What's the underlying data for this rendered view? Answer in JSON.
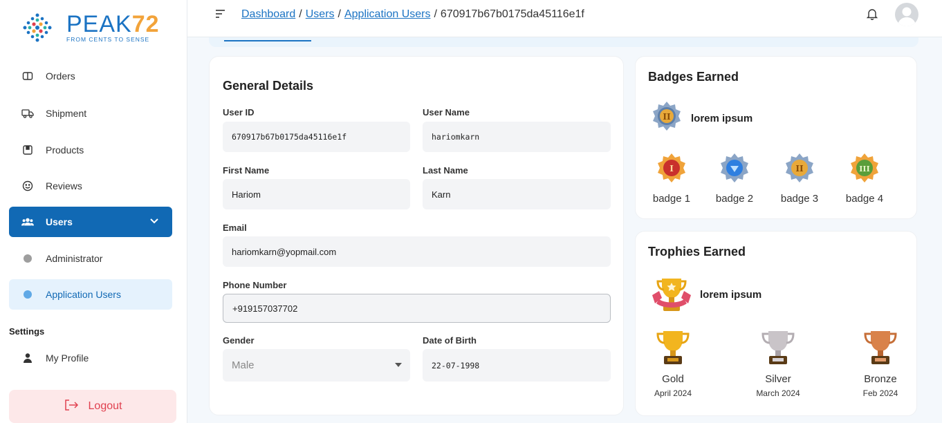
{
  "brand": {
    "name": "PEAK",
    "number": "72",
    "tagline": "FROM CENTS TO SENSE"
  },
  "sidebar": {
    "items": [
      {
        "label": "Orders",
        "icon": "orders-icon"
      },
      {
        "label": "Shipment",
        "icon": "truck-icon"
      },
      {
        "label": "Products",
        "icon": "box-icon"
      },
      {
        "label": "Reviews",
        "icon": "smiley-icon"
      },
      {
        "label": "Users",
        "icon": "users-icon"
      },
      {
        "label": "Administrator",
        "icon": "dot-icon"
      },
      {
        "label": "Application Users",
        "icon": "dot-icon"
      }
    ],
    "settings_label": "Settings",
    "settings_items": [
      {
        "label": "My Profile",
        "icon": "person-icon"
      }
    ],
    "logout_label": "Logout"
  },
  "breadcrumb": {
    "items": [
      "Dashboard",
      "Users",
      "Application Users"
    ],
    "current": "670917b67b0175da45116e1f",
    "separator": "/"
  },
  "details": {
    "title": "General Details",
    "user_id_label": "User ID",
    "user_id": "670917b67b0175da45116e1f",
    "user_name_label": "User Name",
    "user_name": "hariomkarn",
    "first_name_label": "First Name",
    "first_name": "Hariom",
    "last_name_label": "Last Name",
    "last_name": "Karn",
    "email_label": "Email",
    "email": "hariomkarn@yopmail.com",
    "phone_label": "Phone Number",
    "phone": "+919157037702",
    "gender_label": "Gender",
    "gender": "Male",
    "dob_label": "Date of Birth",
    "dob": "22-07-1998"
  },
  "badges": {
    "title": "Badges Earned",
    "featured": "lorem ipsum",
    "items": [
      {
        "label": "badge 1",
        "color": "#c9302c",
        "numeral": "I"
      },
      {
        "label": "badge 2",
        "color": "#2f7fe0",
        "numeral": ""
      },
      {
        "label": "badge 3",
        "color": "#e8a93a",
        "numeral": "II"
      },
      {
        "label": "badge 4",
        "color": "#5a9e3a",
        "numeral": "III"
      }
    ]
  },
  "trophies": {
    "title": "Trophies Earned",
    "featured": "lorem ipsum",
    "items": [
      {
        "label": "Gold",
        "date": "April 2024",
        "color": "#f2b51f"
      },
      {
        "label": "Silver",
        "date": "March 2024",
        "color": "#c9c4c8"
      },
      {
        "label": "Bronze",
        "date": "Feb 2024",
        "color": "#d9824a"
      }
    ]
  },
  "colors": {
    "primary": "#1169b4",
    "logout": "#e0404f",
    "accent": "#f2a33a"
  }
}
